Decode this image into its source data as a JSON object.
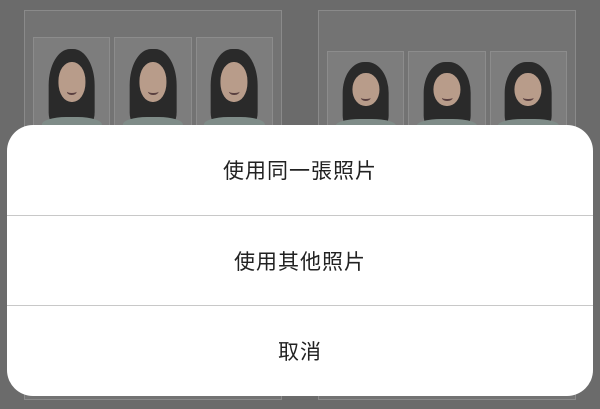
{
  "action_sheet": {
    "options": [
      {
        "label": "使用同一張照片"
      },
      {
        "label": "使用其他照片"
      },
      {
        "label": "取消"
      }
    ]
  },
  "colors": {
    "overlay": "#6b6b6b",
    "sheet_background": "#ffffff",
    "divider": "#c8c8c8",
    "text": "#222222"
  }
}
